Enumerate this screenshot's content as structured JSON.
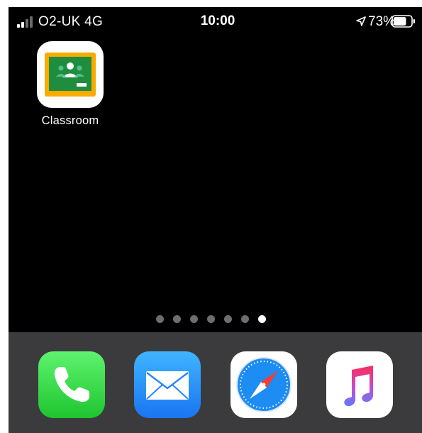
{
  "status_bar": {
    "carrier": "O2-UK  4G",
    "time": "10:00",
    "battery_percent": "73%",
    "signal_bars_active": 2,
    "signal_bars_total": 4,
    "battery_level": 0.73
  },
  "home": {
    "apps": [
      {
        "label": "Classroom",
        "icon": "google-classroom-icon"
      }
    ],
    "page_dots": {
      "count": 7,
      "active_index": 6
    }
  },
  "dock": {
    "apps": [
      {
        "name": "Phone",
        "icon": "phone-icon"
      },
      {
        "name": "Mail",
        "icon": "mail-icon"
      },
      {
        "name": "Safari",
        "icon": "safari-compass-icon"
      },
      {
        "name": "Music",
        "icon": "music-note-icon"
      }
    ]
  },
  "colors": {
    "screen_background": "#000000",
    "dock_background": "#3b3b3d",
    "classroom_green": "#1e8e3e",
    "classroom_yellow": "#f9ab00",
    "phone_green": "#2fd442",
    "mail_blue": "#1f8cf8",
    "safari_blue": "#1d8cf3",
    "music_pink": "#fa2d55"
  }
}
